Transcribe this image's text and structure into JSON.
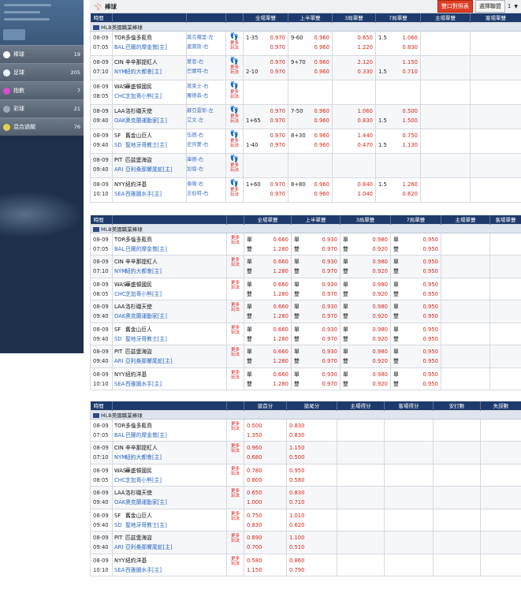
{
  "sidebar": {
    "items": [
      {
        "label": "棒球",
        "count": "19",
        "icon": "baseball-icon",
        "color": "#ffffff"
      },
      {
        "label": "足球",
        "count": "205",
        "icon": "soccer-icon",
        "color": "#e8f1ff"
      },
      {
        "label": "指數",
        "count": "7",
        "icon": "index-icon",
        "color": "#d64dd2"
      },
      {
        "label": "彩球",
        "count": "21",
        "icon": "lottery-icon",
        "color": "#9aa7b8"
      },
      {
        "label": "混合過關",
        "count": "76",
        "icon": "parlay-icon",
        "color": "#e6d34a"
      }
    ]
  },
  "topbar": {
    "title": "棒球",
    "btn_compare": "雙口對照表",
    "btn_select": "選擇聯盟",
    "page": "1"
  },
  "league": "MLB美國職業棒球",
  "more_label_1": "更多",
  "more_label_2": "玩法",
  "section1": {
    "headers": [
      "時間",
      "",
      "",
      "",
      "全場單雙",
      "上半單雙",
      "3局單雙",
      "7局單雙",
      "主場單雙",
      "客場單雙"
    ],
    "rows": [
      {
        "date": "08-09",
        "time": "07:05",
        "h_abbr": "TOR",
        "h_name": "多倫多藍鳥",
        "a_abbr": "BAL",
        "a_name": "巴爾的摩金鶯[主]",
        "p1": "莫克羅里-左",
        "p2": "奧寶斯-右",
        "c1": [
          [
            "1-35",
            "0.970"
          ],
          [
            "",
            "0.970"
          ]
        ],
        "c2": [
          [
            "9-60",
            "0.960"
          ],
          [
            "",
            "0.960"
          ]
        ],
        "c3": [
          [
            "",
            "0.650"
          ],
          [
            "",
            "1.220"
          ]
        ],
        "c4": [
          [
            "1.5",
            "1.060"
          ],
          [
            "",
            "0.830"
          ]
        ]
      },
      {
        "date": "08-09",
        "time": "07:10",
        "h_abbr": "CIN",
        "h_name": "辛辛那提紅人",
        "a_abbr": "NYM",
        "a_name": "紐約大都會[主]",
        "p1": "蒙恩-右",
        "p2": "巴爾特-右",
        "c1": [
          [
            "",
            "0.970"
          ],
          [
            "2-10",
            "0.970"
          ]
        ],
        "c2": [
          [
            "9+70",
            "0.960"
          ],
          [
            "",
            "0.960"
          ]
        ],
        "c3": [
          [
            "",
            "2.120"
          ],
          [
            "",
            "0.330"
          ]
        ],
        "c4": [
          [
            "",
            "1.150"
          ],
          [
            "1.5",
            "0.710"
          ]
        ]
      },
      {
        "date": "08-09",
        "time": "08:05",
        "h_abbr": "WAS",
        "h_name": "華盛頓國民",
        "a_abbr": "CHC",
        "a_name": "芝加哥小熊[主]",
        "p1": "葛萊士-右",
        "p2": "羅德森-右",
        "c1": [
          [
            "",
            ""
          ],
          [
            "",
            ""
          ]
        ],
        "c2": [
          [
            "",
            ""
          ],
          [
            "",
            ""
          ]
        ],
        "c3": [
          [
            "",
            ""
          ],
          [
            "",
            ""
          ]
        ],
        "c4": [
          [
            "",
            ""
          ],
          [
            "",
            ""
          ]
        ]
      },
      {
        "date": "08-09",
        "time": "09:40",
        "h_abbr": "LAA",
        "h_name": "洛杉磯天使",
        "a_abbr": "OAK",
        "a_name": "奧克蘭運動家[主]",
        "p1": "蘇亞雷斯-左",
        "p2": "艾文-左",
        "c1": [
          [
            "",
            "0.970"
          ],
          [
            "1+65",
            "0.970"
          ]
        ],
        "c2": [
          [
            "7-50",
            "0.960"
          ],
          [
            "",
            "0.960"
          ]
        ],
        "c3": [
          [
            "",
            "1.060"
          ],
          [
            "",
            "0.830"
          ]
        ],
        "c4": [
          [
            "",
            "0.500"
          ],
          [
            "1.5",
            "1.500"
          ]
        ]
      },
      {
        "date": "08-09",
        "time": "09:40",
        "h_abbr": "SF",
        "h_name": "舊金山巨人",
        "a_abbr": "SD",
        "a_name": "聖地牙哥教士[主]",
        "p1": "伍德-右",
        "p2": "史貝蒙-右",
        "c1": [
          [
            "",
            "0.970"
          ],
          [
            "1-40",
            "0.970"
          ]
        ],
        "c2": [
          [
            "8+30",
            "0.960"
          ],
          [
            "",
            "0.960"
          ]
        ],
        "c3": [
          [
            "",
            "1.440"
          ],
          [
            "",
            "0.470"
          ]
        ],
        "c4": [
          [
            "",
            "0.750"
          ],
          [
            "1.5",
            "1.130"
          ]
        ]
      },
      {
        "date": "08-09",
        "time": "09:40",
        "h_abbr": "PIT",
        "h_name": "匹茲堡海盜",
        "a_abbr": "ARI",
        "a_name": "亞利桑那響尾蛇[主]",
        "p1": "庫德-右",
        "p2": "加倫-右",
        "c1": [
          [
            "",
            ""
          ],
          [
            "",
            ""
          ]
        ],
        "c2": [
          [
            "",
            ""
          ],
          [
            "",
            ""
          ]
        ],
        "c3": [
          [
            "",
            ""
          ],
          [
            "",
            ""
          ]
        ],
        "c4": [
          [
            "",
            ""
          ],
          [
            "",
            ""
          ]
        ]
      },
      {
        "date": "08-09",
        "time": "10:10",
        "h_abbr": "NYY",
        "h_name": "紐約洋基",
        "a_abbr": "SEA",
        "a_name": "西雅圖水手[主]",
        "p1": "泰隆-右",
        "p2": "吉伯特-右",
        "c1": [
          [
            "1+60",
            "0.970"
          ],
          [
            "",
            "0.970"
          ]
        ],
        "c2": [
          [
            "8+80",
            "0.960"
          ],
          [
            "",
            "0.960"
          ]
        ],
        "c3": [
          [
            "",
            "0.840"
          ],
          [
            "",
            "1.040"
          ]
        ],
        "c4": [
          [
            "1.5",
            "1.260"
          ],
          [
            "",
            "0.620"
          ]
        ]
      }
    ]
  },
  "section2": {
    "headers": [
      "時間",
      "",
      "",
      "全場單雙",
      "上半單雙",
      "3局單雙",
      "7局單雙",
      "主場單雙",
      "客場單雙"
    ],
    "odd_label": "單",
    "even_label": "雙",
    "rows": [
      {
        "date": "08-09",
        "time": "07:05",
        "h_abbr": "TOR",
        "h_name": "多倫多藍鳥",
        "a_abbr": "BAL",
        "a_name": "巴爾的摩金鶯[主]",
        "v": [
          [
            "0.660",
            "1.280"
          ],
          [
            "0.930",
            "0.970"
          ],
          [
            "0.980",
            "0.920"
          ],
          [
            "0.950",
            "0.950"
          ]
        ]
      },
      {
        "date": "08-09",
        "time": "07:10",
        "h_abbr": "CIN",
        "h_name": "辛辛那提紅人",
        "a_abbr": "NYM",
        "a_name": "紐約大都會[主]",
        "v": [
          [
            "0.660",
            "1.280"
          ],
          [
            "0.930",
            "0.970"
          ],
          [
            "0.980",
            "0.920"
          ],
          [
            "0.950",
            "0.950"
          ]
        ]
      },
      {
        "date": "08-09",
        "time": "08:05",
        "h_abbr": "WAS",
        "h_name": "華盛頓國民",
        "a_abbr": "CHC",
        "a_name": "芝加哥小熊[主]",
        "v": [
          [
            "0.660",
            "1.280"
          ],
          [
            "0.930",
            "0.970"
          ],
          [
            "0.980",
            "0.920"
          ],
          [
            "0.950",
            "0.950"
          ]
        ]
      },
      {
        "date": "08-09",
        "time": "09:40",
        "h_abbr": "LAA",
        "h_name": "洛杉磯天使",
        "a_abbr": "OAK",
        "a_name": "奧克蘭運動家[主]",
        "v": [
          [
            "0.660",
            "1.280"
          ],
          [
            "0.930",
            "0.970"
          ],
          [
            "0.980",
            "0.920"
          ],
          [
            "0.950",
            "0.950"
          ]
        ]
      },
      {
        "date": "08-09",
        "time": "09:40",
        "h_abbr": "SF",
        "h_name": "舊金山巨人",
        "a_abbr": "SD",
        "a_name": "聖地牙哥教士[主]",
        "v": [
          [
            "0.660",
            "1.280"
          ],
          [
            "0.930",
            "0.970"
          ],
          [
            "0.980",
            "0.920"
          ],
          [
            "0.950",
            "0.950"
          ]
        ]
      },
      {
        "date": "08-09",
        "time": "09:40",
        "h_abbr": "PIT",
        "h_name": "匹茲堡海盜",
        "a_abbr": "ARI",
        "a_name": "亞利桑那響尾蛇[主]",
        "v": [
          [
            "0.660",
            "1.280"
          ],
          [
            "0.930",
            "0.970"
          ],
          [
            "0.980",
            "0.920"
          ],
          [
            "0.950",
            "0.950"
          ]
        ]
      },
      {
        "date": "08-09",
        "time": "10:10",
        "h_abbr": "NYY",
        "h_name": "紐約洋基",
        "a_abbr": "SEA",
        "a_name": "西雅圖水手[主]",
        "v": [
          [
            "0.660",
            "1.280"
          ],
          [
            "0.930",
            "0.970"
          ],
          [
            "0.980",
            "0.920"
          ],
          [
            "0.950",
            "0.950"
          ]
        ]
      }
    ]
  },
  "section3": {
    "headers": [
      "時間",
      "",
      "",
      "搶首分",
      "搶尾分",
      "主場得分",
      "客場得分",
      "安打數",
      "失誤數"
    ],
    "rows": [
      {
        "date": "08-09",
        "time": "07:05",
        "h_abbr": "TOR",
        "h_name": "多倫多藍鳥",
        "a_abbr": "BAL",
        "a_name": "巴爾的摩金鶯[主]",
        "v": [
          [
            "0.500",
            "1.350"
          ],
          [
            "0.830",
            "0.830"
          ]
        ]
      },
      {
        "date": "08-09",
        "time": "07:10",
        "h_abbr": "CIN",
        "h_name": "辛辛那提紅人",
        "a_abbr": "NYM",
        "a_name": "紐約大都會[主]",
        "v": [
          [
            "0.960",
            "0.680"
          ],
          [
            "1.150",
            "0.500"
          ]
        ]
      },
      {
        "date": "08-09",
        "time": "08:05",
        "h_abbr": "WAS",
        "h_name": "華盛頓國民",
        "a_abbr": "CHC",
        "a_name": "芝加哥小熊[主]",
        "v": [
          [
            "0.780",
            "0.800"
          ],
          [
            "0.950",
            "0.580"
          ]
        ]
      },
      {
        "date": "08-09",
        "time": "09:40",
        "h_abbr": "LAA",
        "h_name": "洛杉磯天使",
        "a_abbr": "OAK",
        "a_name": "奧克蘭運動家[主]",
        "v": [
          [
            "0.650",
            "1.000"
          ],
          [
            "0.830",
            "0.710"
          ]
        ]
      },
      {
        "date": "08-09",
        "time": "09:40",
        "h_abbr": "SF",
        "h_name": "舊金山巨人",
        "a_abbr": "SD",
        "a_name": "聖地牙哥教士[主]",
        "v": [
          [
            "0.750",
            "0.830"
          ],
          [
            "1.010",
            "0.620"
          ]
        ]
      },
      {
        "date": "08-09",
        "time": "09:40",
        "h_abbr": "PIT",
        "h_name": "匹茲堡海盜",
        "a_abbr": "ARI",
        "a_name": "亞利桑那響尾蛇[主]",
        "v": [
          [
            "0.890",
            "0.700"
          ],
          [
            "1.100",
            "0.510"
          ]
        ]
      },
      {
        "date": "08-09",
        "time": "10:10",
        "h_abbr": "NYY",
        "h_name": "紐約洋基",
        "a_abbr": "SEA",
        "a_name": "西雅圖水手[主]",
        "v": [
          [
            "0.580",
            "1.150"
          ],
          [
            "0.860",
            "0.790"
          ]
        ]
      }
    ]
  }
}
